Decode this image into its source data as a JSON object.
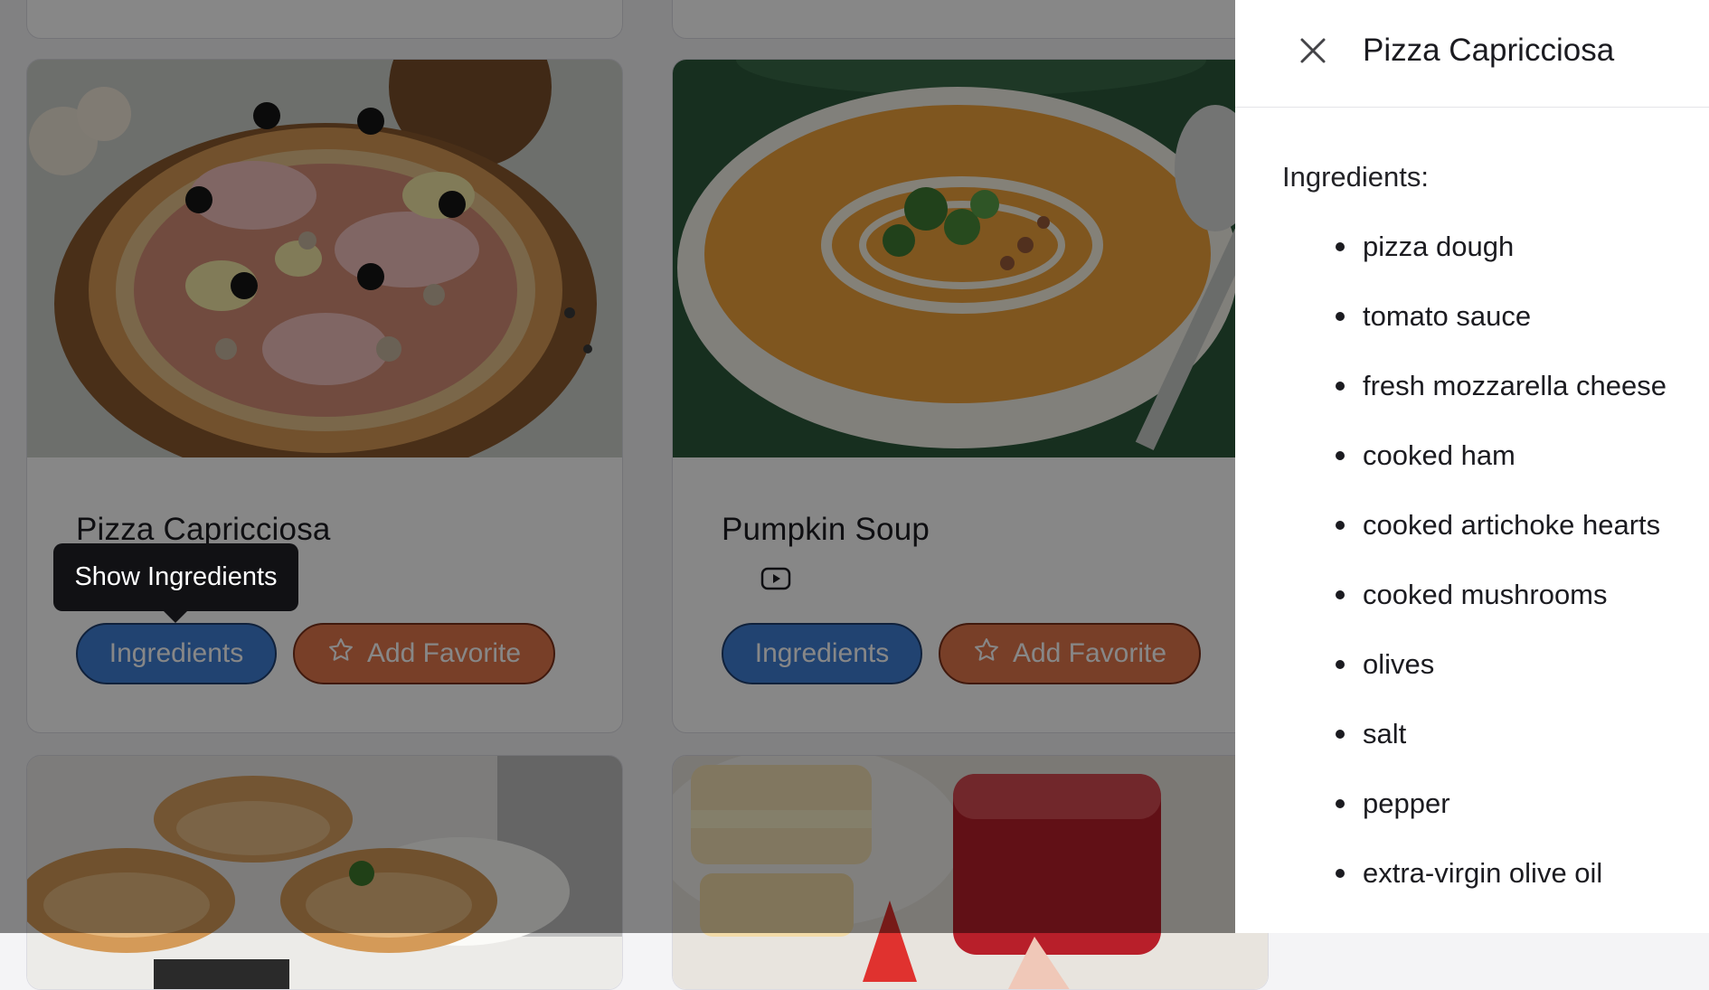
{
  "recipes": [
    {
      "title": "Pizza Capricciosa",
      "ingredients_label": "Ingredients",
      "favorite_label": "Add Favorite"
    },
    {
      "title": "Pumpkin Soup",
      "ingredients_label": "Ingredients",
      "favorite_label": "Add Favorite"
    }
  ],
  "tooltip": {
    "text": "Show Ingredients"
  },
  "drawer": {
    "title": "Pizza Capricciosa",
    "label": "Ingredients:",
    "ingredients": [
      "pizza dough",
      "tomato sauce",
      "fresh mozzarella cheese",
      "cooked ham",
      "cooked artichoke hearts",
      "cooked mushrooms",
      "olives",
      "salt",
      "pepper",
      "extra-virgin olive oil"
    ]
  },
  "icons": {
    "close": "close-icon",
    "star": "star-icon",
    "video": "youtube-play-icon"
  },
  "colors": {
    "ingredients_button": "#3f7fd6",
    "favorite_button": "#e2774d",
    "overlay": "rgba(0,0,0,0.47)",
    "tooltip_bg": "#111114"
  }
}
